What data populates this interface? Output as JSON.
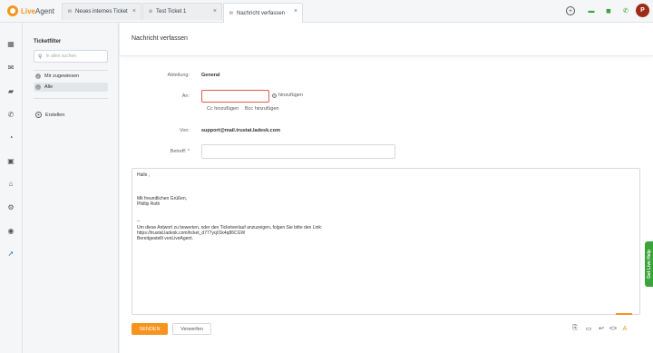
{
  "app": {
    "logo_text_live": "Live",
    "logo_text_agent": "Agent"
  },
  "tabs": [
    {
      "label": "Neues internes Ticket",
      "icon": "envelope-icon"
    },
    {
      "label": "Test Ticket 1",
      "icon": "ticket-icon"
    },
    {
      "label": "Nachricht verfassen",
      "icon": "envelope-icon"
    }
  ],
  "topbar": {
    "avatar_initial": "P",
    "colors": {
      "green": "#3aa33a",
      "avatar": "#9c2b1a"
    }
  },
  "sidebar": {
    "icons": [
      "dashboard-icon",
      "envelope-icon",
      "chat-icon",
      "phone-icon",
      "history-icon",
      "contacts-icon",
      "building-icon",
      "gear-icon",
      "plugin-icon",
      "rocket-icon"
    ]
  },
  "filter_panel": {
    "title": "Ticketfilter",
    "search_placeholder": "In allen suchen",
    "items": [
      {
        "label": "Mir zugewiesen"
      },
      {
        "label": "Alle"
      }
    ],
    "create_label": "Erstellen"
  },
  "compose": {
    "title": "Nachricht verfassen",
    "department_label": "Abteilung:",
    "department_value": "General",
    "to_label": "An:",
    "to_value": "",
    "add_label": "hinzufügen",
    "cc_label": "Cc hinzufügen",
    "bcc_label": "Bcc hinzufügen",
    "from_label": "Von:",
    "from_value": "support@mail.trustat.ladesk.com",
    "subject_label": "Betreff: *",
    "subject_value": "",
    "body": {
      "greeting": "Hallo ,",
      "closing": "Mit freundlichen Grüßen,",
      "signature_name": "Phillip Roth",
      "sig_separator": "--",
      "rating_text": "Um diese Antwort zu bewerten, oder den Ticketverlauf anzuzeigen, folgen Sie bitte den Link:",
      "rating_link": "https://trustat.ladesk.com/ticket_d777yq01k4q86CGW",
      "powered_by": "Bereitgestellt vonLiveAgent."
    },
    "send_label": "SENDEN",
    "discard_label": "Verwerfen",
    "accent_color": "#f7941d"
  },
  "live_help": {
    "label": "Get Live Help"
  }
}
